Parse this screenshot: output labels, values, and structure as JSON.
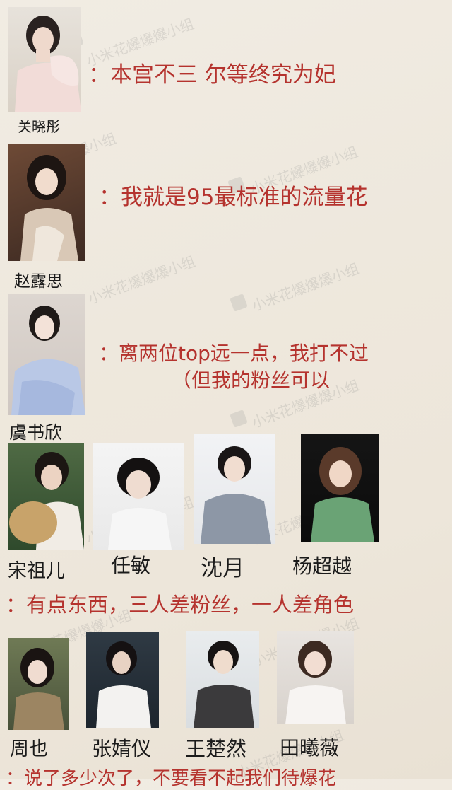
{
  "watermark": "小米花爆爆爆小组",
  "sections": {
    "s1": {
      "name": "关晓彤",
      "quote": "：本宫不三 尔等终究为妃"
    },
    "s2": {
      "name": "赵露思",
      "quote": "：我就是95最标准的流量花"
    },
    "s3": {
      "name": "虞书欣",
      "quote_line1": "：离两位top远一点，我打不过",
      "quote_line2": "（但我的粉丝可以"
    },
    "group1": {
      "names": [
        "宋祖儿",
        "任敏",
        "沈月",
        "杨超越"
      ],
      "quote": "：有点东西，三人差粉丝，一人差角色"
    },
    "group2": {
      "names": [
        "周也",
        "张婧仪",
        "王楚然",
        "田曦薇"
      ],
      "quote": "：说了多少次了，不要看不起我们待爆花"
    }
  },
  "colors": {
    "quote_red": "#b5332e",
    "name_black": "#1b1b1b",
    "background": "#eee8dd"
  }
}
